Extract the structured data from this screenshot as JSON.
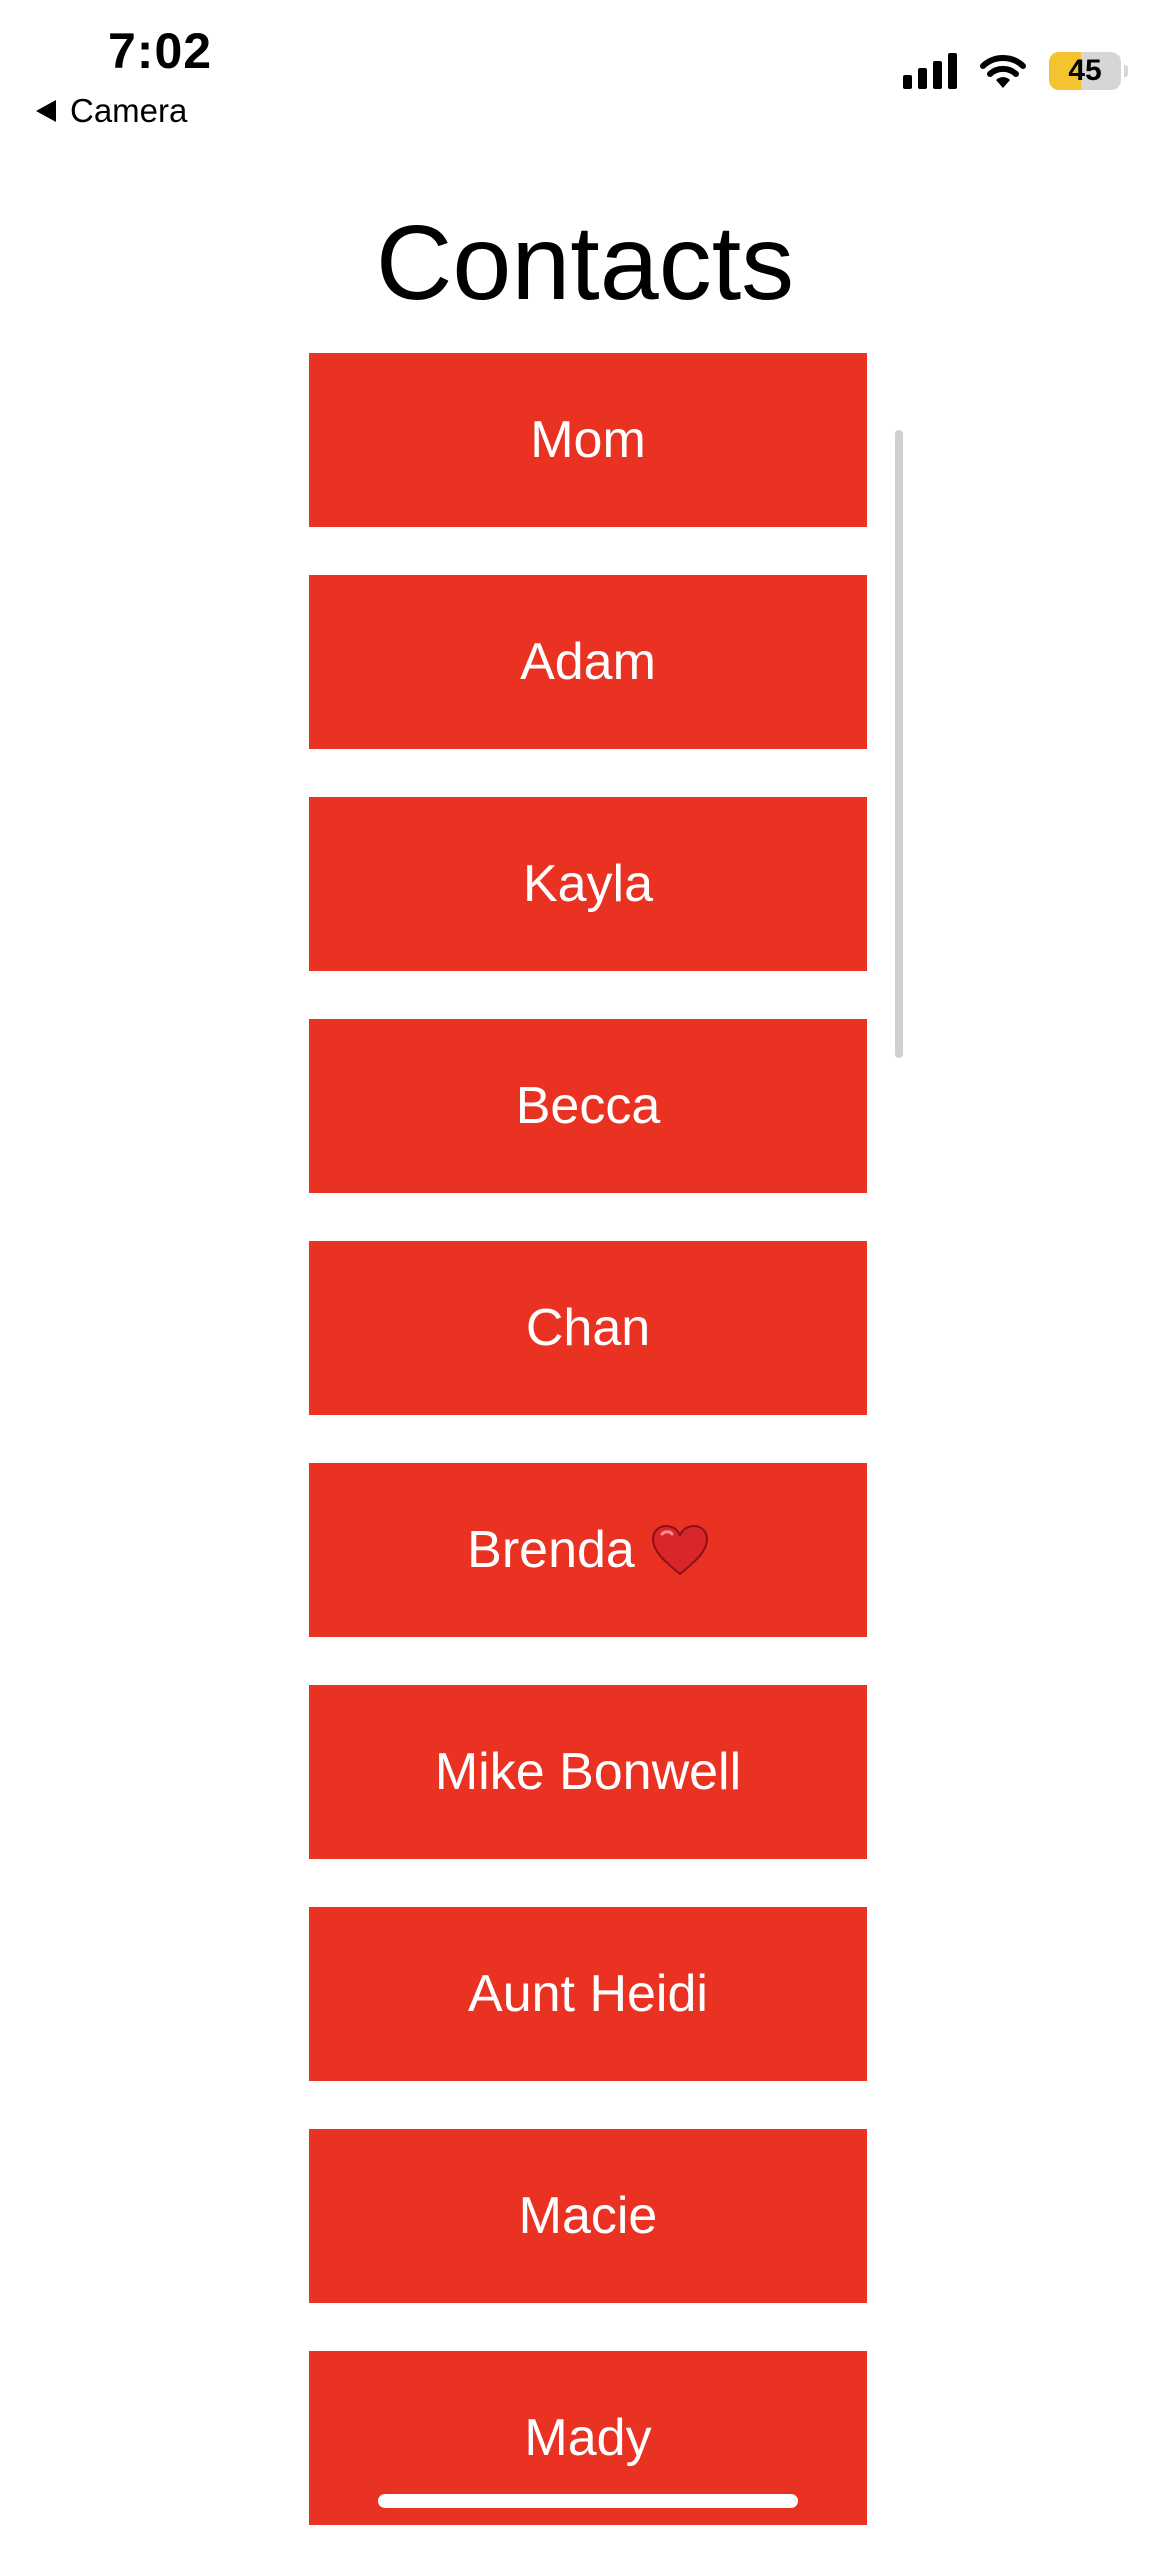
{
  "status_bar": {
    "time": "7:02",
    "back_label": "Camera",
    "battery_level": "45",
    "battery_fraction": 0.45
  },
  "title": "Contacts",
  "contacts": [
    {
      "label": "Mom"
    },
    {
      "label": "Adam"
    },
    {
      "label": "Kayla"
    },
    {
      "label": "Becca"
    },
    {
      "label": "Chan"
    },
    {
      "label": "Brenda",
      "emoji": "heart-icon"
    },
    {
      "label": "Mike Bonwell"
    },
    {
      "label": "Aunt Heidi"
    },
    {
      "label": "Macie"
    },
    {
      "label": "Mady"
    }
  ],
  "colors": {
    "button_background": "#ea3223",
    "button_text": "#ffffff",
    "battery_fill": "#f4c430"
  }
}
